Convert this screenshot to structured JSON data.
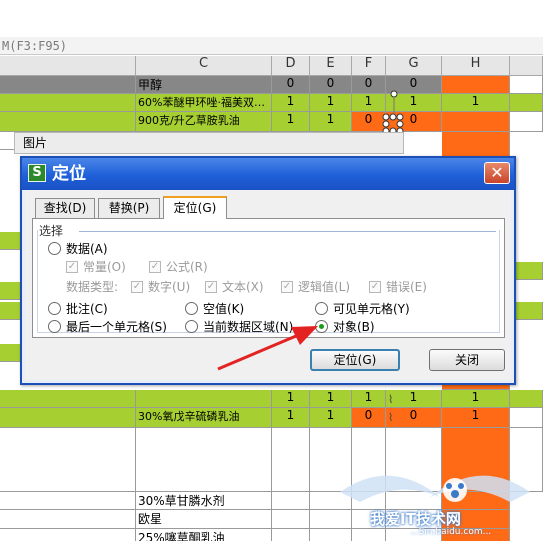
{
  "formula_bar": {
    "text": "M(F3:F95)"
  },
  "columns": [
    "C",
    "D",
    "E",
    "F",
    "G",
    "H"
  ],
  "colors": {
    "green": "#a6cf32",
    "orange": "#ff6a16",
    "gray_row": "#878787",
    "dialog_blue": "#1f5fd8",
    "arrow": "#e32222"
  },
  "rows": [
    {
      "c": "甲醇",
      "d": "0",
      "e": "0",
      "f": "0",
      "g": "0",
      "h": ""
    },
    {
      "c": "60%苯醚甲环唑·福美双…",
      "d": "1",
      "e": "1",
      "f": "1",
      "g": "1",
      "h": "1"
    },
    {
      "c": "900克/升乙草胺乳油",
      "d": "1",
      "e": "1",
      "f": "0",
      "g": "0",
      "h": ""
    },
    {
      "c": "",
      "d": "1",
      "e": "1",
      "f": "1",
      "g": "1",
      "h": "1"
    },
    {
      "c": "30%氧戊辛硫磷乳油",
      "d": "1",
      "e": "1",
      "f": "0",
      "g": "0",
      "h": "1"
    },
    {
      "c": "30%草甘膦水剂"
    },
    {
      "c": "欧星"
    },
    {
      "c": "25%噻草酮乳油"
    }
  ],
  "picture_toolbar": {
    "label": "图片"
  },
  "dialog": {
    "title": "定位",
    "app_icon": "S",
    "close_glyph": "✕",
    "tabs": [
      {
        "label": "查找(D)"
      },
      {
        "label": "替换(P)"
      },
      {
        "label": "定位(G)"
      }
    ],
    "group_label": "选择",
    "data_option": "数据(A)",
    "constant": "常量(O)",
    "formula": "公式(R)",
    "data_type_label": "数据类型:",
    "number": "数字(U)",
    "text": "文本(X)",
    "logical": "逻辑值(L)",
    "error": "错误(E)",
    "comment": "批注(C)",
    "blank": "空值(K)",
    "visible_cells": "可见单元格(Y)",
    "last_cell": "最后一个单元格(S)",
    "current_region": "当前数据区域(N)",
    "objects": "对象(B)",
    "selected_option": "对象(B)",
    "goto_button": "定位(G)",
    "close_button": "关闭"
  },
  "watermark": {
    "text": "我爱IT技术网",
    "url": "...Sin.baidu.com..."
  }
}
